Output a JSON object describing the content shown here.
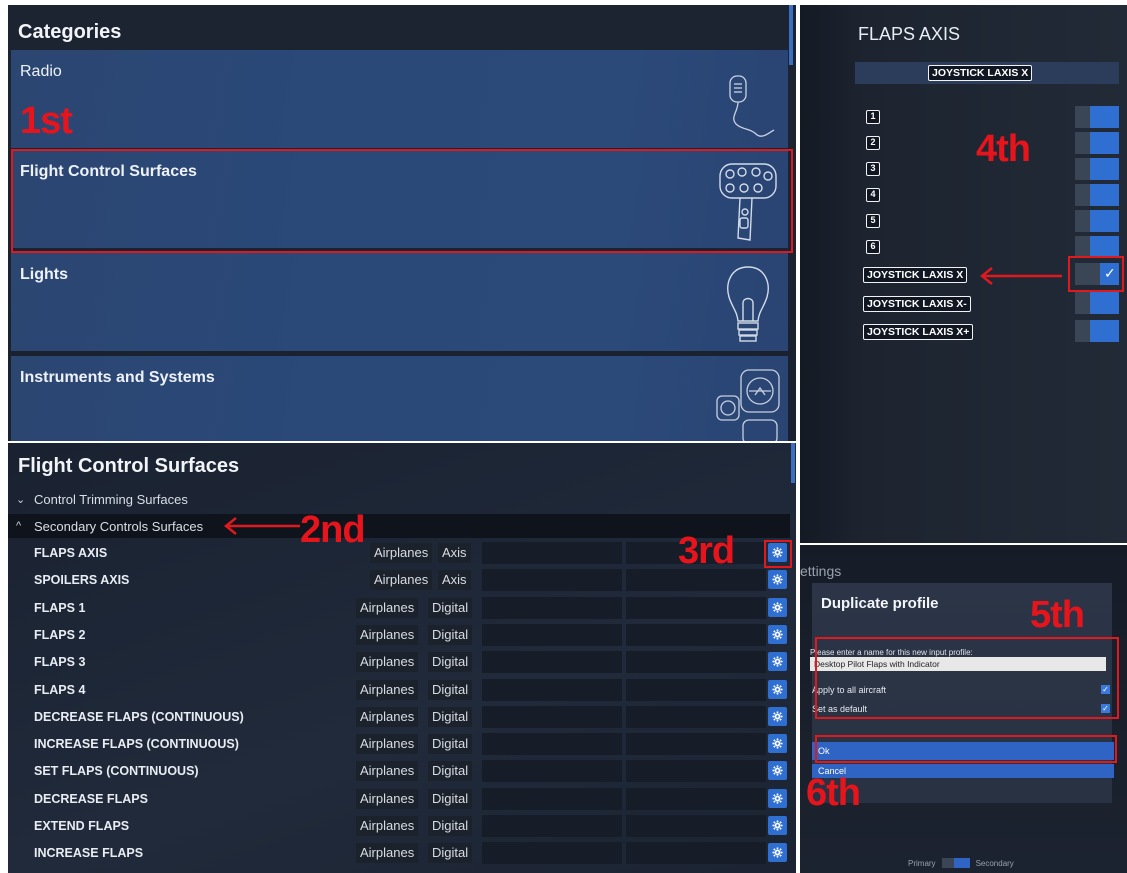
{
  "categories": {
    "title": "Categories",
    "items": [
      {
        "label": "Radio",
        "icon": "microphone-icon"
      },
      {
        "label": "Flight Control Surfaces",
        "icon": "yoke-icon"
      },
      {
        "label": "Lights",
        "icon": "lightbulb-icon"
      },
      {
        "label": "Instruments and Systems",
        "icon": "instruments-icon"
      }
    ]
  },
  "fcs": {
    "title": "Flight Control Surfaces",
    "groups": [
      {
        "label": "Control Trimming Surfaces",
        "chevron": "⌄"
      },
      {
        "label": "Secondary Controls Surfaces",
        "chevron": "^"
      }
    ],
    "rows": [
      {
        "name": "FLAPS AXIS",
        "aircraft": "Airplanes",
        "type": "Axis"
      },
      {
        "name": "SPOILERS AXIS",
        "aircraft": "Airplanes",
        "type": "Axis"
      },
      {
        "name": "FLAPS 1",
        "aircraft": "Airplanes",
        "type": "Digital"
      },
      {
        "name": "FLAPS 2",
        "aircraft": "Airplanes",
        "type": "Digital"
      },
      {
        "name": "FLAPS 3",
        "aircraft": "Airplanes",
        "type": "Digital"
      },
      {
        "name": "FLAPS 4",
        "aircraft": "Airplanes",
        "type": "Digital"
      },
      {
        "name": "DECREASE FLAPS (CONTINUOUS)",
        "aircraft": "Airplanes",
        "type": "Digital"
      },
      {
        "name": "INCREASE FLAPS (CONTINUOUS)",
        "aircraft": "Airplanes",
        "type": "Digital"
      },
      {
        "name": "SET FLAPS (CONTINUOUS)",
        "aircraft": "Airplanes",
        "type": "Digital"
      },
      {
        "name": "DECREASE FLAPS",
        "aircraft": "Airplanes",
        "type": "Digital"
      },
      {
        "name": "EXTEND FLAPS",
        "aircraft": "Airplanes",
        "type": "Digital"
      },
      {
        "name": "INCREASE FLAPS",
        "aircraft": "Airplanes",
        "type": "Digital"
      }
    ]
  },
  "axis_panel": {
    "title": "FLAPS AXIS",
    "current_binding": "JOYSTICK LAXIS X",
    "options": [
      {
        "label": "1",
        "on": false
      },
      {
        "label": "2",
        "on": false
      },
      {
        "label": "3",
        "on": false
      },
      {
        "label": "4",
        "on": false
      },
      {
        "label": "5",
        "on": false
      },
      {
        "label": "6",
        "on": false
      },
      {
        "label": "JOYSTICK LAXIS X",
        "on": true
      },
      {
        "label": "JOYSTICK LAXIS X-",
        "on": false
      },
      {
        "label": "JOYSTICK LAXIS X+",
        "on": false
      }
    ]
  },
  "dialog": {
    "settings_label": "ettings",
    "title": "Duplicate profile",
    "prompt": "Please enter a name for this new input profile:",
    "name_value": "Desktop Pilot Flaps with Indicator",
    "apply_all_label": "Apply to all aircraft",
    "set_default_label": "Set as default",
    "ok_label": "Ok",
    "cancel_label": "Cancel",
    "primary_label": "Primary",
    "secondary_label": "Secondary"
  },
  "annotations": {
    "first": "1st",
    "second": "2nd",
    "third": "3rd",
    "fourth": "4th",
    "fifth": "5th",
    "sixth": "6th"
  },
  "colors": {
    "accent_blue": "#2f6fd1",
    "annotation_red": "#e0191f",
    "card_blue": "#2b4a7a"
  }
}
